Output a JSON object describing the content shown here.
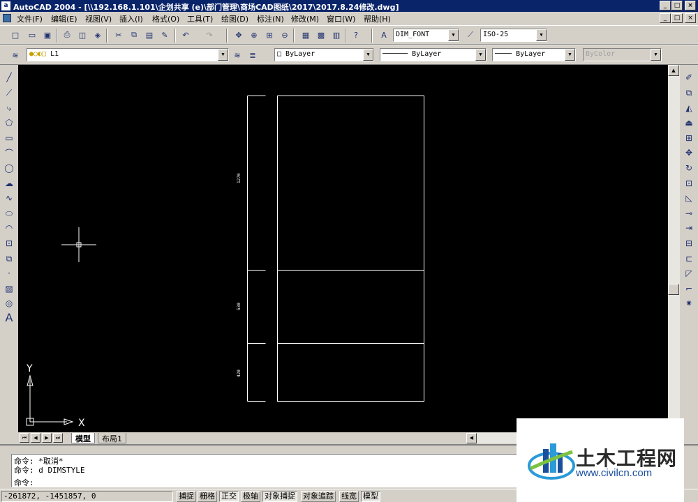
{
  "window": {
    "app_icon": "a",
    "title": "AutoCAD 2004 - [\\\\192.168.1.101\\企划共享 (e)\\部门管理\\商场CAD图纸\\2017\\2017.8.24修改.dwg]",
    "controls": [
      "_",
      "□",
      "×"
    ],
    "doc_controls": [
      "_",
      "□",
      "×"
    ]
  },
  "menu": {
    "items": [
      "文件(F)",
      "编辑(E)",
      "视图(V)",
      "插入(I)",
      "格式(O)",
      "工具(T)",
      "绘图(D)",
      "标注(N)",
      "修改(M)",
      "窗口(W)",
      "帮助(H)"
    ]
  },
  "standard_toolbar": {
    "text_style": "DIM_FONT",
    "dim_style": "ISO-25"
  },
  "layers_toolbar": {
    "layer_name": "L1",
    "color": "ByLayer",
    "linetype": "ByLayer",
    "lineweight": "ByLayer",
    "plot_style": "ByColor"
  },
  "drawing": {
    "dimensions": [
      "1270",
      "530",
      "420"
    ],
    "ucs": {
      "x_label": "X",
      "y_label": "Y"
    }
  },
  "tabs": {
    "model": "模型",
    "layout": "布局1"
  },
  "command": {
    "lines": [
      "命令: *取消*",
      "命令: d DIMSTYLE",
      "命令:"
    ]
  },
  "status": {
    "coords": "-261872, -1451857, 0",
    "toggles": [
      {
        "label": "捕捉",
        "on": false
      },
      {
        "label": "栅格",
        "on": false
      },
      {
        "label": "正交",
        "on": true
      },
      {
        "label": "极轴",
        "on": false
      },
      {
        "label": "对象捕捉",
        "on": true
      },
      {
        "label": "对象追踪",
        "on": false
      },
      {
        "label": "线宽",
        "on": false
      },
      {
        "label": "模型",
        "on": true
      }
    ]
  },
  "watermark": {
    "name": "土木工程网",
    "url": "www.civilcn.com"
  },
  "colors": {
    "titlebar": "#0a246a",
    "canvas": "#000000",
    "chrome": "#d4d0c8",
    "drawing_lines": "#ffffff"
  }
}
